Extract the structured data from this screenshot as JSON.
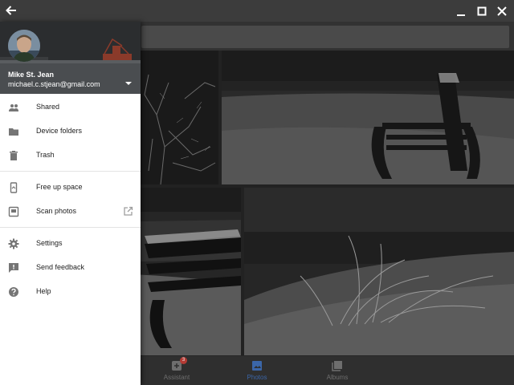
{
  "titlebar": {
    "back_icon": "arrow-back-icon",
    "minimize_icon": "minimize-icon",
    "maximize_icon": "maximize-icon",
    "close_icon": "close-icon"
  },
  "account": {
    "name": "Mike St. Jean",
    "email": "michael.c.stjean@gmail.com"
  },
  "menu": {
    "group1": [
      {
        "label": "Shared",
        "icon": "people-icon"
      },
      {
        "label": "Device folders",
        "icon": "folder-icon"
      },
      {
        "label": "Trash",
        "icon": "trash-icon"
      }
    ],
    "group2": [
      {
        "label": "Free up space",
        "icon": "phone-free-space-icon"
      },
      {
        "label": "Scan photos",
        "icon": "scan-photo-icon",
        "trailing_icon": "open-external-icon"
      }
    ],
    "group3": [
      {
        "label": "Settings",
        "icon": "gear-icon"
      },
      {
        "label": "Send feedback",
        "icon": "feedback-icon"
      },
      {
        "label": "Help",
        "icon": "help-icon"
      }
    ]
  },
  "bottom_nav": {
    "items": [
      {
        "label": "Assistant",
        "icon": "assistant-icon",
        "badge": "3"
      },
      {
        "label": "Photos",
        "icon": "photos-icon",
        "active": true
      },
      {
        "label": "Albums",
        "icon": "albums-icon"
      }
    ]
  },
  "colors": {
    "titlebar": "#3c3c3c",
    "drawer_bg": "#ffffff",
    "menu_text": "#212121",
    "menu_icon": "#757575",
    "active_nav": "#3b66a8",
    "badge": "#b43a34"
  }
}
